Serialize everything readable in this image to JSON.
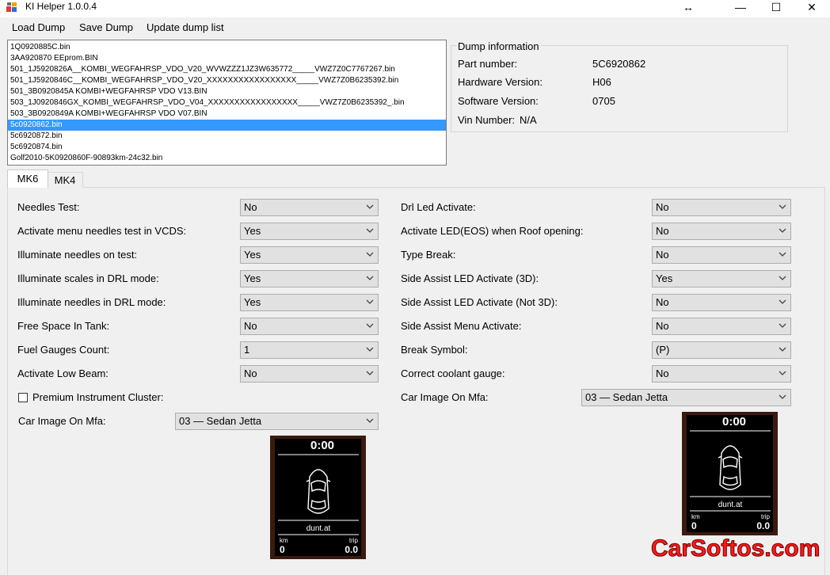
{
  "window": {
    "title": "KI Helper 1.0.0.4",
    "resize_glyph": "↔",
    "minimize_glyph": "—",
    "maximize_glyph": "☐",
    "close_glyph": "✕"
  },
  "menu": {
    "items": [
      "Load Dump",
      "Save Dump",
      "Update dump list"
    ]
  },
  "dump_list": {
    "items": [
      "1Q0920885C.bin",
      "3AA920870 EEprom.BIN",
      "501_1J5920826A__KOMBI_WEGFAHRSP_VDO_V20_WVWZZZ1JZ3W635772_____VWZ7Z0C7767267.bin",
      "501_1J5920846C__KOMBI_WEGFAHRSP_VDO_V20_XXXXXXXXXXXXXXXXX_____VWZ7Z0B6235392.bin",
      "501_3B0920845A  KOMBI+WEGFAHRSP VDO V13.BIN",
      "503_1J0920846GX_KOMBI_WEGFAHRSP_VDO_V04_XXXXXXXXXXXXXXXXX_____VWZ7Z0B6235392_.bin",
      "503_3B0920849A  KOMBI+WEGFAHRSP VDO V07.BIN",
      "5c0920862.bin",
      "5c6920872.bin",
      "5c6920874.bin",
      "Golf2010-5K0920860F-90893km-24c32.bin"
    ],
    "selected_index": 7
  },
  "dump_info": {
    "legend": "Dump information",
    "part_number_label": "Part number:",
    "part_number": "5C6920862",
    "hardware_label": "Hardware Version:",
    "hardware": "H06",
    "software_label": "Software Version:",
    "software": "0705",
    "vin_label": "Vin Number:",
    "vin": "N/A"
  },
  "tabs": [
    {
      "label": "MK6",
      "active": true
    },
    {
      "label": "MK4",
      "active": false
    }
  ],
  "left_fields": [
    {
      "label": "Needles Test:",
      "value": "No"
    },
    {
      "label": "Activate menu needles test in VCDS:",
      "value": "Yes"
    },
    {
      "label": "Illuminate needles on test:",
      "value": "Yes"
    },
    {
      "label": "Illuminate scales in DRL mode:",
      "value": "Yes"
    },
    {
      "label": "Illuminate needles in DRL mode:",
      "value": "Yes"
    },
    {
      "label": "Free Space In Tank:",
      "value": "No"
    },
    {
      "label": "Fuel Gauges Count:",
      "value": "1"
    },
    {
      "label": "Activate Low Beam:",
      "value": "No"
    }
  ],
  "right_fields": [
    {
      "label": "Drl Led Activate:",
      "value": "No"
    },
    {
      "label": "Activate LED(EOS) when Roof opening:",
      "value": "No"
    },
    {
      "label": "Type Break:",
      "value": "No"
    },
    {
      "label": "Side Assist LED Activate (3D):",
      "value": "Yes"
    },
    {
      "label": "Side Assist LED Activate (Not 3D):",
      "value": "No"
    },
    {
      "label": "Side Assist Menu Activate:",
      "value": "No"
    },
    {
      "label": "Break Symbol:",
      "value": "(P)"
    },
    {
      "label": "Correct coolant gauge:",
      "value": "No"
    }
  ],
  "premium_checkbox": {
    "label": "Premium Instrument Cluster:",
    "checked": false
  },
  "car_image_left": {
    "label": "Car Image On Mfa:",
    "value": "03 — Sedan Jetta"
  },
  "car_image_right": {
    "label": "Car Image On Mfa:",
    "value": "03 — Sedan Jetta"
  },
  "mfa_preview": {
    "time": "0:00",
    "site": "dunt.at",
    "km_label": "km",
    "km_value": "0",
    "trip_label": "trip",
    "trip_value": "0.0"
  },
  "watermark": {
    "text": "CarSoftos.com",
    "color": "#ff1a1a"
  }
}
